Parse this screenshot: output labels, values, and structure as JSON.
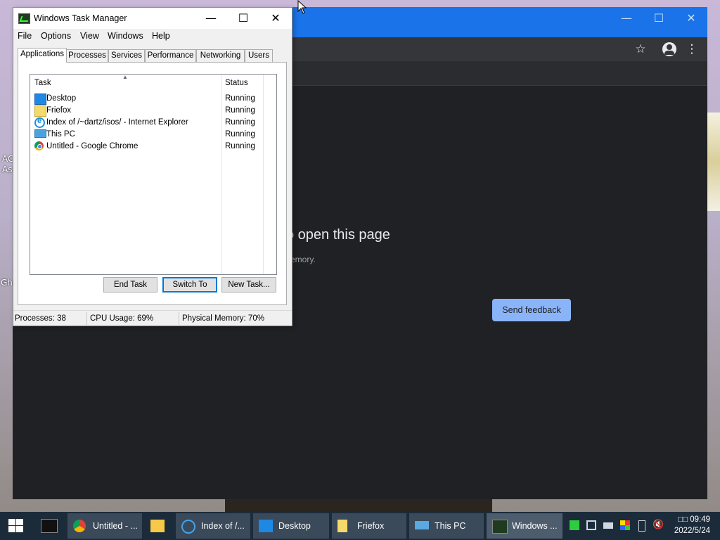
{
  "desktop": {
    "icon_text_a": "AC",
    "icon_text_b": "As",
    "icon_text_c": "Gh"
  },
  "chrome": {
    "controls": {
      "minimize": "—",
      "maximize": "☐",
      "close": "✕"
    },
    "bookmark_icon": "☆",
    "menu_icon": "⋮",
    "error_title": "o open this page",
    "error_sub": "emory.",
    "feedback_button": "Send feedback"
  },
  "task_manager": {
    "title": "Windows Task Manager",
    "controls": {
      "minimize": "—",
      "maximize": "☐",
      "close": "✕"
    },
    "menu": [
      "File",
      "Options",
      "View",
      "Windows",
      "Help"
    ],
    "tabs": [
      "Applications",
      "Processes",
      "Services",
      "Performance",
      "Networking",
      "Users"
    ],
    "columns": {
      "task": "Task",
      "status": "Status"
    },
    "rows": [
      {
        "icon": "desktop-icon",
        "task": "Desktop",
        "status": "Running"
      },
      {
        "icon": "folder-icon",
        "task": "Friefox",
        "status": "Running"
      },
      {
        "icon": "internet-explorer-icon",
        "task": "Index of /~dartz/isos/ - Internet Explorer",
        "status": "Running"
      },
      {
        "icon": "this-pc-icon",
        "task": "This PC",
        "status": "Running"
      },
      {
        "icon": "chrome-icon",
        "task": "Untitled - Google Chrome",
        "status": "Running"
      }
    ],
    "buttons": {
      "end_task": "End Task",
      "switch_to": "Switch To",
      "new_task": "New Task..."
    },
    "status": {
      "processes": "Processes: 38",
      "cpu": "CPU Usage: 69%",
      "memory": "Physical Memory: 70%"
    }
  },
  "taskbar": {
    "items": [
      {
        "icon": "chrome-icon",
        "label": "Untitled - ..."
      },
      {
        "icon": "file-explorer-icon",
        "label": ""
      },
      {
        "icon": "internet-explorer-icon",
        "label": "Index of /..."
      },
      {
        "icon": "desktop-icon",
        "label": "Desktop"
      },
      {
        "icon": "folder-icon",
        "label": "Friefox"
      },
      {
        "icon": "this-pc-icon",
        "label": "This PC"
      },
      {
        "icon": "task-manager-icon",
        "label": "Windows ..."
      }
    ],
    "clock_time": "□□ 09:49",
    "clock_date": "2022/5/24"
  }
}
